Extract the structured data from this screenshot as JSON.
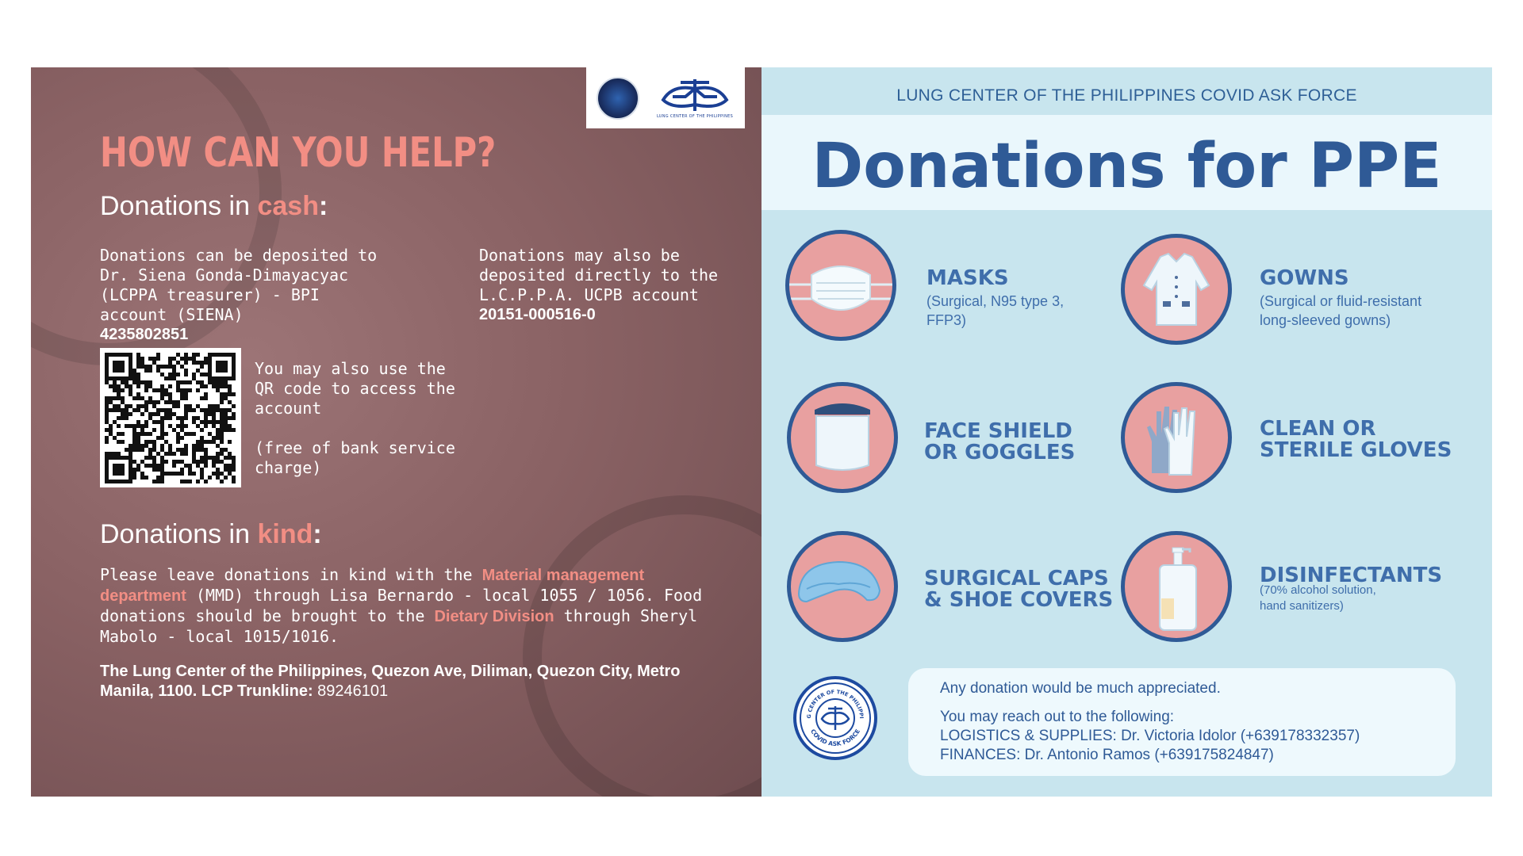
{
  "left": {
    "title": "HOW CAN YOU HELP?",
    "cash_heading": {
      "pre": "Donations in ",
      "hl": "cash",
      "colon": ":"
    },
    "cash_col1": {
      "text": "Donations can be deposited to Dr. Siena Gonda-Dimayacyac (LCPPA treasurer) - BPI account (SIENA)",
      "account": "4235802851"
    },
    "cash_col2": {
      "text": "Donations may also be deposited directly to the L.C.P.P.A. UCPB account",
      "account": "20151-000516-0"
    },
    "qr_text": {
      "line1": "You may also use the QR code to access the account",
      "line2": "(free of bank service charge)"
    },
    "kind_heading": {
      "pre": "Donations in ",
      "hl": "kind",
      "colon": ":"
    },
    "kind": {
      "t1": "Please leave donations in kind with the ",
      "hl1": "Material management department",
      "t2": " (MMD) through Lisa Bernardo - local 1055 / 1056. Food donations should be brought to the ",
      "hl2": "Dietary Division",
      "t3": " through Sheryl Mabolo - local 1015/1016."
    },
    "address": {
      "bold": "The Lung Center of the Philippines, Quezon Ave, Diliman, Quezon City, Metro Manila, 1100. LCP Trunkline:",
      "trunkline": " 89246101"
    },
    "logo_caption": "LUNG CENTER OF THE PHILIPPINES"
  },
  "right": {
    "org": "LUNG CENTER OF THE PHILIPPINES COVID ASK FORCE",
    "title": "Donations for PPE",
    "items": [
      {
        "title1": "MASKS",
        "sub": "(Surgical, N95 type 3,",
        "sub2": "FFP3)",
        "icon": "mask-icon"
      },
      {
        "title1": "GOWNS",
        "sub": "(Surgical or fluid-resistant",
        "sub2": "long-sleeved gowns)",
        "icon": "gown-icon"
      },
      {
        "title1": "FACE SHIELD",
        "title2": "OR GOGGLES",
        "icon": "face-shield-icon"
      },
      {
        "title1": "CLEAN OR",
        "title2": "STERILE GLOVES",
        "icon": "gloves-icon"
      },
      {
        "title1": "SURGICAL CAPS",
        "title2": "& SHOE COVERS",
        "icon": "surgical-cap-icon"
      },
      {
        "title1": "DISINFECTANTS",
        "sub": "(70% alcohol solution,",
        "sub2": "hand sanitizers)",
        "icon": "sanitizer-icon"
      }
    ],
    "contact": {
      "line1": "Any donation would be much appreciated.",
      "line2": "You may reach out to the following:",
      "line3": "LOGISTICS & SUPPLIES: Dr. Victoria Idolor (+639178332357)",
      "line4": "FINANCES: Dr. Antonio Ramos (+639175824847)"
    },
    "seal": {
      "top": "LUNG CENTER OF THE PHILIPPINES",
      "bottom": "COVID ASK FORCE"
    }
  },
  "colors": {
    "coral": "#f28e84",
    "navy": "#2f5a96",
    "panel_bg": "#c8e5ee",
    "circle": "#e8a0a0"
  }
}
